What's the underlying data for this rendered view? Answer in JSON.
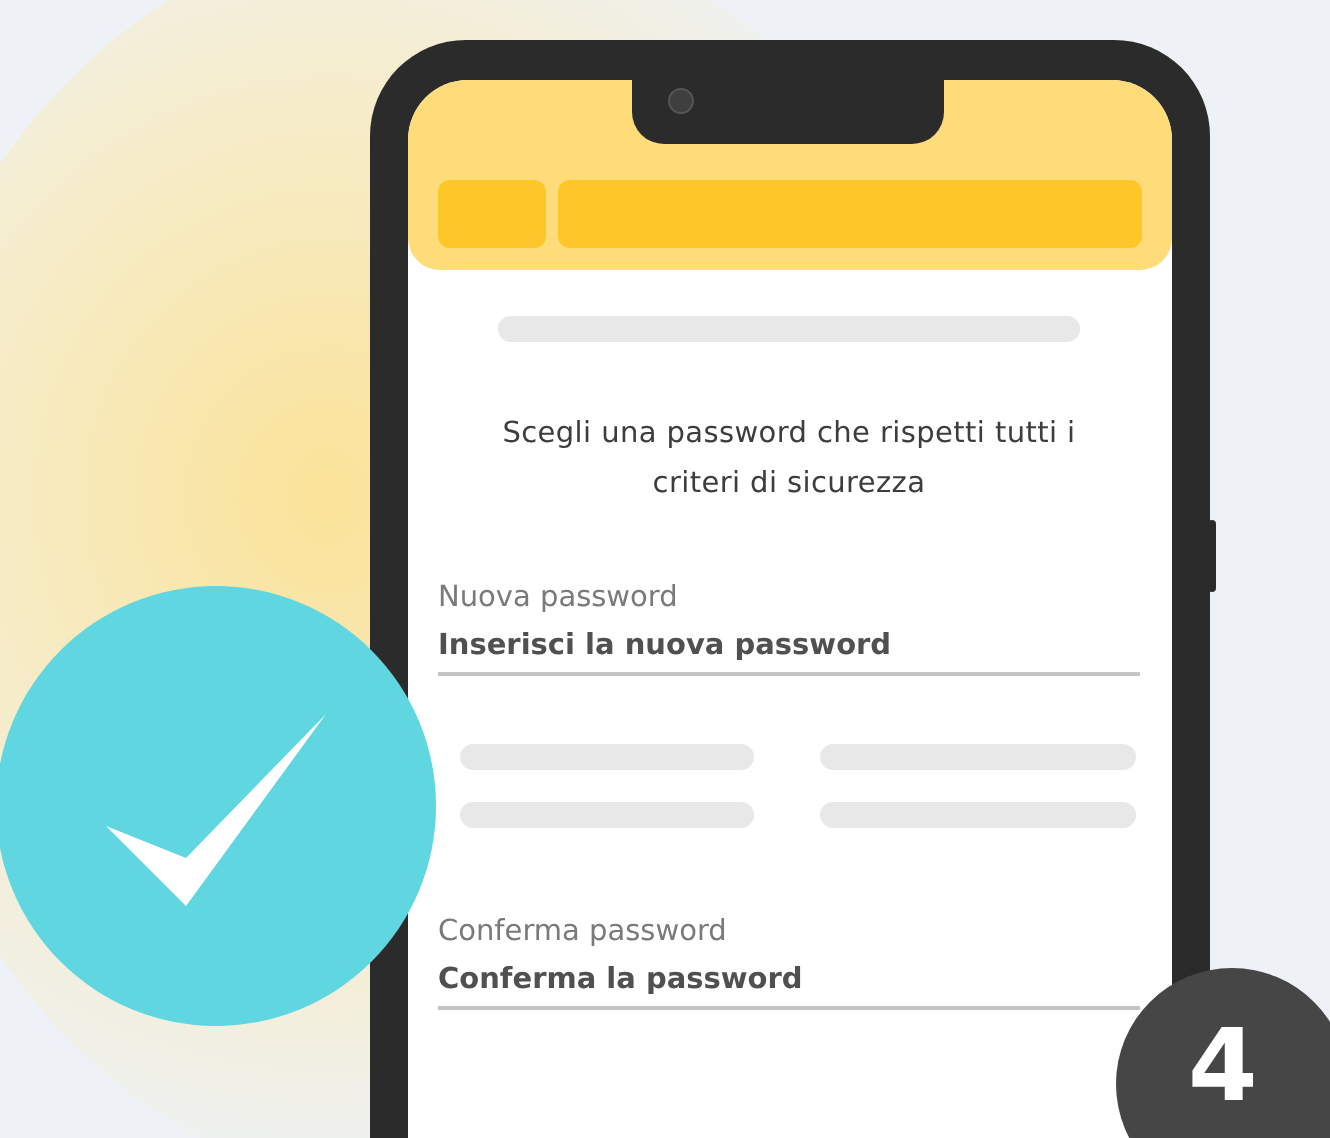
{
  "heading": "Scegli una password che rispetti tutti i criteri di sicurezza",
  "fields": [
    {
      "label": "Nuova password",
      "placeholder": "Inserisci la nuova password"
    },
    {
      "label": "Conferma password",
      "placeholder": "Conferma la password"
    }
  ],
  "step_badge": "4"
}
